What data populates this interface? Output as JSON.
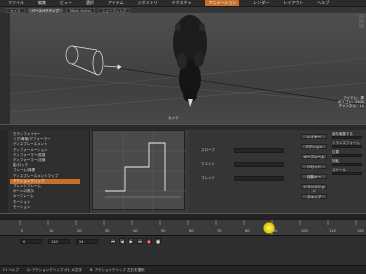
{
  "menubar": {
    "items": [
      "ファイル",
      "編集",
      "ビュー",
      "選択",
      "アイテム",
      "ジオメトリ",
      "テクスチャ",
      "アニメーション",
      "レンダー",
      "レイアウト",
      "ヘルプ"
    ],
    "active_index": 7
  },
  "viewport_tabs": [
    "カメラ",
    "パースペクティブ",
    "Mesh Select",
    "シェーディング"
  ],
  "viewport": {
    "info_lines": [
      "アイテム：犀",
      "ポリゴン：2400",
      "チャンネル：12"
    ],
    "label": "カメラ"
  },
  "left_panel": {
    "items": [
      "モディファイヤー",
      "リグ/骨格/デフォーマー",
      "ディスプレースメント",
      "ディフォーメーション",
      "ディフォーマー/変換",
      "ディフォーマー/法線",
      "影/ロック",
      "フレーム/時間",
      "ディスプレースメントマップ",
      "アクションクリップ",
      "ブレンドフレーム",
      "ボーンの表示",
      "キーフレーム",
      "モーション",
      "モーション"
    ],
    "selected_index": 9,
    "extra_items": [
      "キーフレーム",
      "プロジェクト",
      "重ね合わせ",
      "パスの表示",
      "フィルター"
    ]
  },
  "properties": {
    "rows": [
      "スロープ",
      "ウエイト",
      "ブレンド"
    ],
    "buttons": [
      "レイヤー",
      "アクション",
      "キーフレーム",
      "リセット",
      "自動キー",
      "トランジション",
      "スキップ"
    ],
    "right_labels": [
      "値を編集する",
      "トランスフォーム",
      "位置",
      "回転",
      "スケール"
    ]
  },
  "timeline": {
    "ticks": [
      "0",
      "10",
      "20",
      "30",
      "40",
      "50",
      "60",
      "70",
      "80",
      "90",
      "100",
      "110",
      "120"
    ],
    "playhead_frame": "90"
  },
  "playbar": {
    "frame_field": "0",
    "end_field": "120",
    "fps": "24"
  },
  "statusbar": {
    "left": "F1 ヘルプ",
    "mid": "Q: アクションクリップ (F): 大文字",
    "right": "B: アクションクリップ 左右を選択"
  },
  "colors": {
    "accent": "#c7702b",
    "background": "#3a3a3a",
    "viewport": "#4b4b4b",
    "panel": "#2f2f2f"
  }
}
